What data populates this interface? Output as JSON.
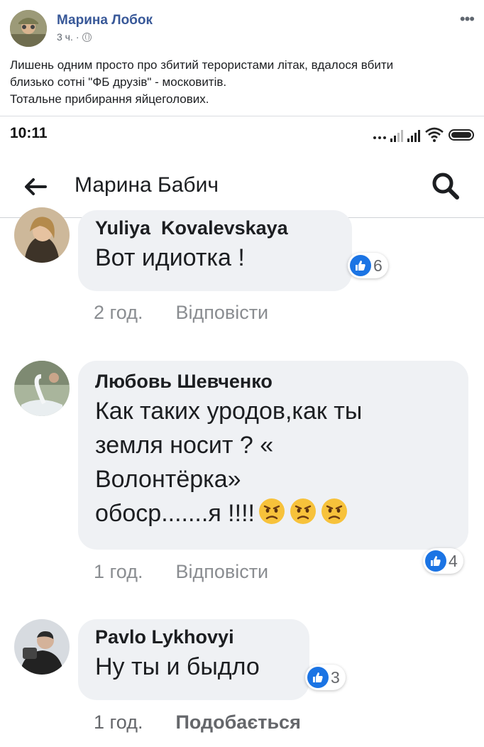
{
  "post": {
    "author": "Марина Лобок",
    "time": "3 ч.",
    "separator": "·",
    "more_icon": "more-dots-icon",
    "text_lines": [
      "Лишень одним просто про збитий терористами літак, вдалося вбити",
      "близько сотні \"ФБ друзів\" - московитів.",
      "Тотальне прибирання яйцеголових."
    ]
  },
  "statusbar": {
    "time": "10:11"
  },
  "app": {
    "title": "Марина Бабич"
  },
  "comments": [
    {
      "author": "Yuliya  Kovalevskaya",
      "text": "Вот идиотка !",
      "time": "2 год.",
      "action": "Відповісти",
      "reactions": "6"
    },
    {
      "author": "Любовь Шевченко",
      "text_lines": [
        "Как таких уродов,как ты",
        "земля носит ? «",
        "Волонтёрка»",
        "обоср.......я !!!!"
      ],
      "emoji": "angry-face",
      "emoji_count": 3,
      "time": "1 год.",
      "action": "Відповісти",
      "reactions": "4"
    },
    {
      "author": "Pavlo Lykhovyi",
      "text": "Ну ты и быдло",
      "time": "1 год.",
      "action": "Подобається",
      "reactions": "3"
    }
  ],
  "colors": {
    "link": "#385898",
    "like_blue": "#1b74e4",
    "bubble": "#eff1f4"
  }
}
